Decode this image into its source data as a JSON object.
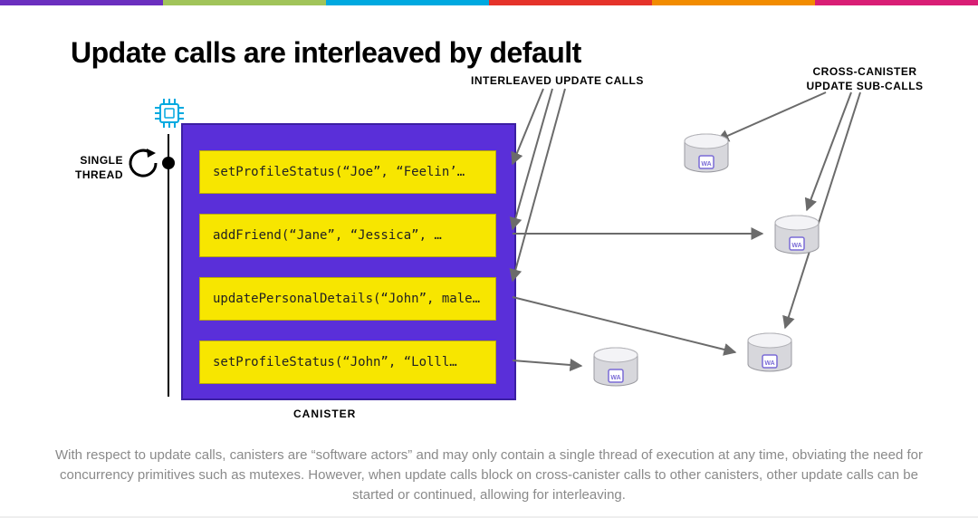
{
  "title": "Update calls are interleaved by default",
  "labels": {
    "interleaved": "INTERLEAVED UPDATE CALLS",
    "cross": "CROSS-CANISTER UPDATE SUB-CALLS",
    "single_thread": "SINGLE THREAD",
    "canister": "CANISTER"
  },
  "calls": {
    "c1": "setProfileStatus(“Joe”, “Feelin’…",
    "c2": "addFriend(“Jane”, “Jessica”, …",
    "c3": "updatePersonalDetails(“John”, male…",
    "c4": "setProfileStatus(“John”, “Lolll…"
  },
  "canister_badge": "WA",
  "description": "With respect to update calls, canisters are “software actors” and may only contain a single thread of execution at any time, obviating the need for concurrency primitives such as mutexes. However, when update calls block on cross-canister calls to other canisters, other update calls can be started or continued, allowing for interleaving.",
  "colors": {
    "accent_purple": "#5a2fd9",
    "accent_yellow": "#f7e600",
    "topbar": [
      "#6b2fbf",
      "#a1c45a",
      "#00a9e0",
      "#e5332a",
      "#f28c00",
      "#d91e75"
    ]
  }
}
